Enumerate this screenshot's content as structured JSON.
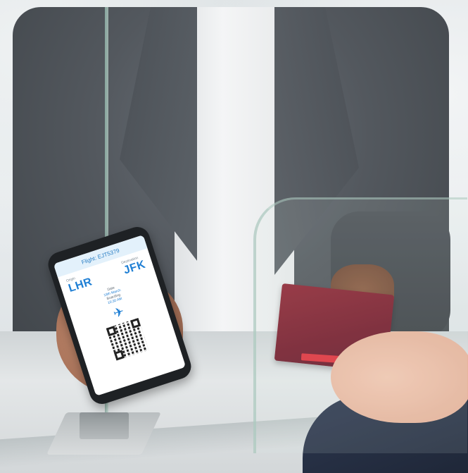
{
  "boarding_pass": {
    "flight": "Flight: EJT5379",
    "origin_label": "Origin",
    "origin_code": "LHR",
    "destination_label": "Destination",
    "destination_code": "JFK",
    "date_label": "Date",
    "date_value": "18th March",
    "boarding_label": "Boarding",
    "boarding_value": "10:30 AM",
    "accent_color": "#1f7fd4"
  },
  "passport": {
    "color": "#7a1b2c"
  }
}
